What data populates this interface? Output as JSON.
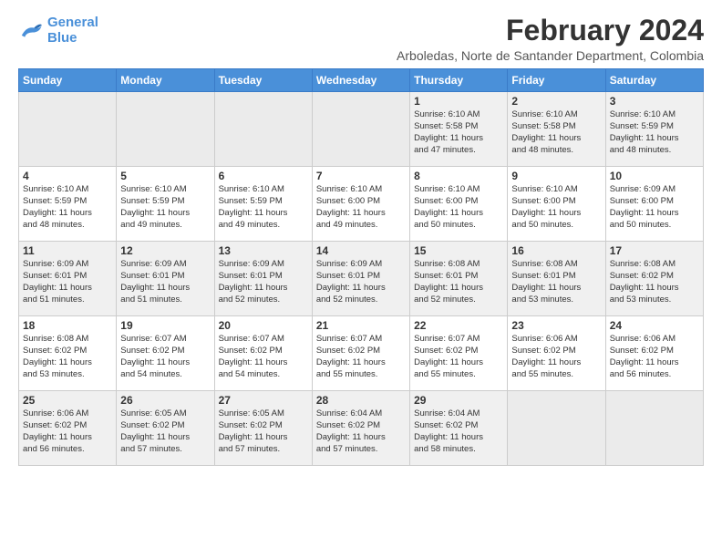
{
  "logo": {
    "line1": "General",
    "line2": "Blue"
  },
  "title": "February 2024",
  "subtitle": "Arboledas, Norte de Santander Department, Colombia",
  "days_header": [
    "Sunday",
    "Monday",
    "Tuesday",
    "Wednesday",
    "Thursday",
    "Friday",
    "Saturday"
  ],
  "weeks": [
    [
      {
        "day": "",
        "info": ""
      },
      {
        "day": "",
        "info": ""
      },
      {
        "day": "",
        "info": ""
      },
      {
        "day": "",
        "info": ""
      },
      {
        "day": "1",
        "info": "Sunrise: 6:10 AM\nSunset: 5:58 PM\nDaylight: 11 hours\nand 47 minutes."
      },
      {
        "day": "2",
        "info": "Sunrise: 6:10 AM\nSunset: 5:58 PM\nDaylight: 11 hours\nand 48 minutes."
      },
      {
        "day": "3",
        "info": "Sunrise: 6:10 AM\nSunset: 5:59 PM\nDaylight: 11 hours\nand 48 minutes."
      }
    ],
    [
      {
        "day": "4",
        "info": "Sunrise: 6:10 AM\nSunset: 5:59 PM\nDaylight: 11 hours\nand 48 minutes."
      },
      {
        "day": "5",
        "info": "Sunrise: 6:10 AM\nSunset: 5:59 PM\nDaylight: 11 hours\nand 49 minutes."
      },
      {
        "day": "6",
        "info": "Sunrise: 6:10 AM\nSunset: 5:59 PM\nDaylight: 11 hours\nand 49 minutes."
      },
      {
        "day": "7",
        "info": "Sunrise: 6:10 AM\nSunset: 6:00 PM\nDaylight: 11 hours\nand 49 minutes."
      },
      {
        "day": "8",
        "info": "Sunrise: 6:10 AM\nSunset: 6:00 PM\nDaylight: 11 hours\nand 50 minutes."
      },
      {
        "day": "9",
        "info": "Sunrise: 6:10 AM\nSunset: 6:00 PM\nDaylight: 11 hours\nand 50 minutes."
      },
      {
        "day": "10",
        "info": "Sunrise: 6:09 AM\nSunset: 6:00 PM\nDaylight: 11 hours\nand 50 minutes."
      }
    ],
    [
      {
        "day": "11",
        "info": "Sunrise: 6:09 AM\nSunset: 6:01 PM\nDaylight: 11 hours\nand 51 minutes."
      },
      {
        "day": "12",
        "info": "Sunrise: 6:09 AM\nSunset: 6:01 PM\nDaylight: 11 hours\nand 51 minutes."
      },
      {
        "day": "13",
        "info": "Sunrise: 6:09 AM\nSunset: 6:01 PM\nDaylight: 11 hours\nand 52 minutes."
      },
      {
        "day": "14",
        "info": "Sunrise: 6:09 AM\nSunset: 6:01 PM\nDaylight: 11 hours\nand 52 minutes."
      },
      {
        "day": "15",
        "info": "Sunrise: 6:08 AM\nSunset: 6:01 PM\nDaylight: 11 hours\nand 52 minutes."
      },
      {
        "day": "16",
        "info": "Sunrise: 6:08 AM\nSunset: 6:01 PM\nDaylight: 11 hours\nand 53 minutes."
      },
      {
        "day": "17",
        "info": "Sunrise: 6:08 AM\nSunset: 6:02 PM\nDaylight: 11 hours\nand 53 minutes."
      }
    ],
    [
      {
        "day": "18",
        "info": "Sunrise: 6:08 AM\nSunset: 6:02 PM\nDaylight: 11 hours\nand 53 minutes."
      },
      {
        "day": "19",
        "info": "Sunrise: 6:07 AM\nSunset: 6:02 PM\nDaylight: 11 hours\nand 54 minutes."
      },
      {
        "day": "20",
        "info": "Sunrise: 6:07 AM\nSunset: 6:02 PM\nDaylight: 11 hours\nand 54 minutes."
      },
      {
        "day": "21",
        "info": "Sunrise: 6:07 AM\nSunset: 6:02 PM\nDaylight: 11 hours\nand 55 minutes."
      },
      {
        "day": "22",
        "info": "Sunrise: 6:07 AM\nSunset: 6:02 PM\nDaylight: 11 hours\nand 55 minutes."
      },
      {
        "day": "23",
        "info": "Sunrise: 6:06 AM\nSunset: 6:02 PM\nDaylight: 11 hours\nand 55 minutes."
      },
      {
        "day": "24",
        "info": "Sunrise: 6:06 AM\nSunset: 6:02 PM\nDaylight: 11 hours\nand 56 minutes."
      }
    ],
    [
      {
        "day": "25",
        "info": "Sunrise: 6:06 AM\nSunset: 6:02 PM\nDaylight: 11 hours\nand 56 minutes."
      },
      {
        "day": "26",
        "info": "Sunrise: 6:05 AM\nSunset: 6:02 PM\nDaylight: 11 hours\nand 57 minutes."
      },
      {
        "day": "27",
        "info": "Sunrise: 6:05 AM\nSunset: 6:02 PM\nDaylight: 11 hours\nand 57 minutes."
      },
      {
        "day": "28",
        "info": "Sunrise: 6:04 AM\nSunset: 6:02 PM\nDaylight: 11 hours\nand 57 minutes."
      },
      {
        "day": "29",
        "info": "Sunrise: 6:04 AM\nSunset: 6:02 PM\nDaylight: 11 hours\nand 58 minutes."
      },
      {
        "day": "",
        "info": ""
      },
      {
        "day": "",
        "info": ""
      }
    ]
  ]
}
